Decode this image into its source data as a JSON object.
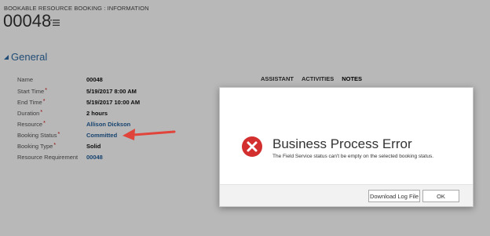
{
  "header": {
    "entity_type": "BOOKABLE RESOURCE BOOKING : INFORMATION",
    "record_number": "00048"
  },
  "section": {
    "title": "General"
  },
  "fields": [
    {
      "label": "Name",
      "value": "00048",
      "required": false,
      "link": false
    },
    {
      "label": "Start Time",
      "value": "5/19/2017   8:00 AM",
      "required": true,
      "link": false
    },
    {
      "label": "End Time",
      "value": "5/19/2017   10:00 AM",
      "required": true,
      "link": false
    },
    {
      "label": "Duration",
      "value": "2 hours",
      "required": true,
      "link": false
    },
    {
      "label": "Resource",
      "value": "Allison Dickson",
      "required": true,
      "link": true
    },
    {
      "label": "Booking Status",
      "value": "Committed",
      "required": true,
      "link": true
    },
    {
      "label": "Booking Type",
      "value": "Solid",
      "required": true,
      "link": false
    },
    {
      "label": "Resource Requirement",
      "value": "00048",
      "required": false,
      "link": true
    }
  ],
  "right_tabs": [
    "ASSISTANT",
    "ACTIVITIES",
    "NOTES"
  ],
  "dialog": {
    "title": "Business Process Error",
    "message": "The Field Service status can't be empty on the selected booking status.",
    "buttons": {
      "download_log": "Download Log File",
      "ok": "OK"
    }
  },
  "colors": {
    "link": "#1f5d9a",
    "section_title": "#2f6aa3",
    "required_marker": "#cc0000",
    "error_icon": "#d32f2f",
    "annotation_arrow": "#e0443a"
  },
  "icons": {
    "title_menu": "hamburger-menu-icon",
    "section_toggle": "triangle-collapse-icon",
    "error": "error-x-circle-icon",
    "annotation": "red-arrow-icon"
  }
}
